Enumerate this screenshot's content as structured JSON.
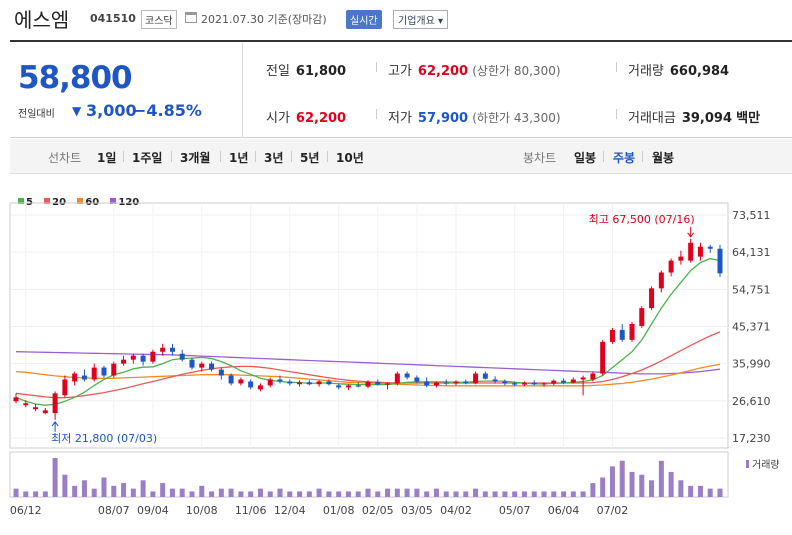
{
  "header": {
    "name": "에스엠",
    "code": "041510",
    "market": "코스닥",
    "date": "2021.07.30  기준(장마감)",
    "realtime_button": "실시간",
    "info_button": "기업개요 ▾"
  },
  "quote": {
    "price": "58,800",
    "compare_label": "전일대비",
    "change_arrow": "▼",
    "change": "3,000",
    "change_pct": "−4.85%",
    "prev_close_label": "전일",
    "prev_close": "61,800",
    "open_label": "시가",
    "open": "62,200",
    "high_label": "고가",
    "high": "62,200",
    "upper_limit": "(상한가 80,300)",
    "low_label": "저가",
    "low": "57,900",
    "lower_limit": "(하한가 43,300)",
    "volume_label": "거래량",
    "volume": "660,984",
    "amount_label": "거래대금",
    "amount": "39,094",
    "amount_unit": "백만"
  },
  "tabs": {
    "line_label": "선차트",
    "line_items": [
      "1일",
      "1주일",
      "3개월",
      "1년",
      "3년",
      "5년",
      "10년"
    ],
    "candle_label": "봉차트",
    "candle_items": [
      "일봉",
      "주봉",
      "월봉"
    ],
    "active": "주봉"
  },
  "colors": {
    "up": "#e0001e",
    "down": "#1e56c5",
    "ma5": "#4bb34b",
    "ma20": "#e85a5a",
    "ma60": "#f08c28",
    "ma120": "#9b5fd4",
    "volume": "#9b7fc6"
  },
  "chart_data": {
    "type": "candlestick",
    "legend": [
      "5",
      "20",
      "60",
      "120"
    ],
    "y_ticks": [
      73511,
      64131,
      54751,
      45371,
      35990,
      26610,
      17230
    ],
    "ylim": [
      17230,
      73511
    ],
    "x_ticks": [
      "06/12",
      "08/07",
      "09/04",
      "10/08",
      "11/06",
      "12/04",
      "01/08",
      "02/05",
      "03/05",
      "04/02",
      "05/07",
      "06/04",
      "07/02"
    ],
    "high_annotation": "최고 67,500 (07/16)",
    "low_annotation": "최저 21,800 (07/03)",
    "volume_label": "거래량",
    "candles": [
      [
        26500,
        28500,
        26000,
        27500
      ],
      [
        25500,
        26800,
        25000,
        26000
      ],
      [
        24500,
        25800,
        24000,
        25000
      ],
      [
        23500,
        24800,
        23200,
        24200
      ],
      [
        23500,
        29000,
        21800,
        28500
      ],
      [
        28000,
        33000,
        27500,
        32000
      ],
      [
        31500,
        34000,
        30500,
        33500
      ],
      [
        33000,
        34500,
        31500,
        32000
      ],
      [
        32000,
        36000,
        31500,
        35000
      ],
      [
        35000,
        35500,
        32500,
        33000
      ],
      [
        33000,
        36500,
        32500,
        36000
      ],
      [
        36000,
        38000,
        35500,
        37000
      ],
      [
        37000,
        38500,
        36000,
        38000
      ],
      [
        38000,
        38500,
        35500,
        36500
      ],
      [
        36500,
        39500,
        36000,
        39000
      ],
      [
        39000,
        41000,
        38000,
        40000
      ],
      [
        40000,
        41000,
        38000,
        39000
      ],
      [
        38500,
        39500,
        36500,
        37000
      ],
      [
        37000,
        37500,
        34500,
        35000
      ],
      [
        35000,
        36500,
        34000,
        36000
      ],
      [
        36000,
        36500,
        34000,
        34500
      ],
      [
        34500,
        35000,
        32000,
        33000
      ],
      [
        33000,
        33500,
        30500,
        31000
      ],
      [
        31000,
        32500,
        30500,
        32000
      ],
      [
        31500,
        32000,
        29500,
        30000
      ],
      [
        29500,
        31000,
        29000,
        30500
      ],
      [
        30500,
        32500,
        30000,
        32000
      ],
      [
        32000,
        33000,
        31000,
        31500
      ],
      [
        31500,
        32000,
        30500,
        31000
      ],
      [
        30800,
        31800,
        30200,
        31300
      ],
      [
        31300,
        31800,
        30500,
        30800
      ],
      [
        30800,
        31800,
        30200,
        31500
      ],
      [
        31500,
        32000,
        30500,
        30800
      ],
      [
        30500,
        31000,
        29500,
        30000
      ],
      [
        30000,
        30800,
        29300,
        30500
      ],
      [
        30500,
        31300,
        30000,
        30200
      ],
      [
        30200,
        31800,
        29800,
        31400
      ],
      [
        31400,
        32000,
        30500,
        30700
      ],
      [
        30700,
        31200,
        29500,
        31000
      ],
      [
        31000,
        34000,
        30500,
        33500
      ],
      [
        33500,
        34000,
        32000,
        32500
      ],
      [
        32500,
        33000,
        31000,
        31500
      ],
      [
        31500,
        32500,
        30000,
        30500
      ],
      [
        30500,
        31500,
        30000,
        31200
      ],
      [
        31200,
        32000,
        30500,
        31000
      ],
      [
        31000,
        31800,
        30500,
        31500
      ],
      [
        31500,
        32000,
        30800,
        31000
      ],
      [
        31000,
        34000,
        30800,
        33500
      ],
      [
        33500,
        34000,
        32000,
        32200
      ],
      [
        32000,
        32800,
        31000,
        31500
      ],
      [
        31500,
        32000,
        30500,
        31000
      ],
      [
        31000,
        31500,
        30300,
        30700
      ],
      [
        30700,
        31500,
        30300,
        31200
      ],
      [
        31200,
        31800,
        30500,
        30800
      ],
      [
        30800,
        31300,
        30200,
        31000
      ],
      [
        31000,
        32000,
        30500,
        31700
      ],
      [
        31700,
        32300,
        30800,
        31200
      ],
      [
        31200,
        32500,
        31000,
        32000
      ],
      [
        32000,
        33000,
        28000,
        32500
      ],
      [
        32000,
        34000,
        31500,
        33500
      ],
      [
        33500,
        42000,
        33000,
        41500
      ],
      [
        41500,
        45000,
        41000,
        44500
      ],
      [
        44500,
        46000,
        41500,
        42000
      ],
      [
        42000,
        46500,
        41500,
        46000
      ],
      [
        45500,
        50500,
        45000,
        50000
      ],
      [
        50000,
        55500,
        49500,
        55000
      ],
      [
        55000,
        59500,
        54000,
        59000
      ],
      [
        59000,
        62500,
        58000,
        62000
      ],
      [
        62000,
        64500,
        61000,
        63000
      ],
      [
        62000,
        67500,
        61500,
        66500
      ],
      [
        63000,
        66500,
        62000,
        65500
      ],
      [
        65500,
        66000,
        64000,
        65000
      ],
      [
        65000,
        66000,
        57900,
        58800
      ]
    ],
    "volume": [
      3,
      2,
      2,
      2,
      14,
      8,
      4,
      6,
      3,
      7,
      4,
      5,
      3,
      6,
      2,
      5,
      3,
      3,
      2,
      4,
      2,
      3,
      3,
      2,
      2,
      3,
      2,
      3,
      2,
      2,
      2,
      3,
      2,
      2,
      2,
      2,
      3,
      2,
      3,
      3,
      3,
      3,
      2,
      3,
      2,
      2,
      2,
      3,
      2,
      2,
      2,
      2,
      2,
      2,
      2,
      2,
      2,
      2,
      2,
      5,
      7,
      11,
      13,
      9,
      8,
      6,
      13,
      9,
      6,
      4,
      4,
      3,
      3
    ],
    "ma5": [
      27500,
      26500,
      25800,
      25500,
      25700,
      26500,
      27500,
      28800,
      30500,
      32000,
      33200,
      33800,
      34700,
      35100,
      35200,
      36000,
      37000,
      37300,
      37400,
      37600,
      37300,
      36500,
      35500,
      34200,
      33300,
      32300,
      31800,
      31500,
      31300,
      31200,
      31000,
      31100,
      31100,
      30900,
      30800,
      30700,
      30700,
      30700,
      30700,
      31000,
      31300,
      31400,
      31400,
      31400,
      31400,
      31300,
      31300,
      31500,
      31600,
      31600,
      31600,
      31300,
      31100,
      30900,
      30900,
      31000,
      31100,
      31300,
      31500,
      31900,
      33000,
      35000,
      37000,
      39000,
      42000,
      46000,
      50000,
      53500,
      56500,
      59500,
      61500,
      62500,
      62000
    ],
    "ma20": [
      28500,
      28200,
      27900,
      27600,
      27400,
      27400,
      27600,
      27900,
      28300,
      28700,
      29200,
      29700,
      30300,
      30900,
      31500,
      32100,
      32700,
      33300,
      33800,
      34300,
      34700,
      35000,
      35200,
      35300,
      35300,
      35100,
      34800,
      34400,
      34000,
      33600,
      33200,
      32800,
      32400,
      32100,
      31800,
      31600,
      31400,
      31300,
      31200,
      31100,
      31100,
      31100,
      31100,
      31100,
      31100,
      31100,
      31100,
      31100,
      31100,
      31100,
      31100,
      31100,
      31100,
      31100,
      31100,
      31100,
      31100,
      31100,
      31100,
      31200,
      31500,
      32000,
      32700,
      33500,
      34400,
      35500,
      36700,
      38000,
      39300,
      40600,
      41800,
      43000,
      44000
    ],
    "ma60": [
      34000,
      33800,
      33500,
      33200,
      32900,
      32700,
      32500,
      32400,
      32300,
      32300,
      32300,
      32400,
      32500,
      32600,
      32700,
      32800,
      32900,
      33000,
      33100,
      33200,
      33200,
      33200,
      33200,
      33100,
      33000,
      32900,
      32800,
      32700,
      32500,
      32300,
      32100,
      31900,
      31700,
      31500,
      31300,
      31200,
      31100,
      31000,
      30900,
      30800,
      30700,
      30600,
      30500,
      30500,
      30400,
      30400,
      30400,
      30400,
      30400,
      30400,
      30400,
      30400,
      30400,
      30400,
      30400,
      30400,
      30400,
      30400,
      30400,
      30500,
      30600,
      30800,
      31000,
      31300,
      31700,
      32100,
      32600,
      33100,
      33700,
      34300,
      34900,
      35400,
      35800
    ],
    "ma120": [
      39000,
      38950,
      38900,
      38850,
      38800,
      38750,
      38700,
      38650,
      38600,
      38550,
      38500,
      38450,
      38400,
      38350,
      38300,
      38250,
      38200,
      38100,
      38000,
      37900,
      37800,
      37700,
      37600,
      37500,
      37400,
      37300,
      37200,
      37100,
      37000,
      36900,
      36800,
      36700,
      36600,
      36500,
      36400,
      36300,
      36200,
      36100,
      36000,
      35900,
      35800,
      35700,
      35600,
      35500,
      35400,
      35300,
      35200,
      35100,
      35000,
      34900,
      34800,
      34700,
      34600,
      34500,
      34400,
      34300,
      34200,
      34100,
      34000,
      33900,
      33800,
      33700,
      33600,
      33500,
      33400,
      33400,
      33400,
      33500,
      33600,
      33800,
      34000,
      34300,
      34600
    ]
  }
}
